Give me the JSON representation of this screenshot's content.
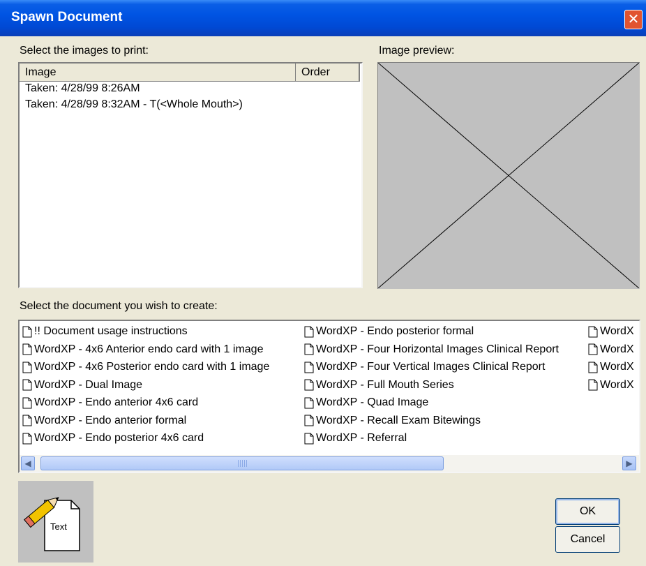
{
  "window": {
    "title": "Spawn Document",
    "close_glyph": "✕"
  },
  "images": {
    "label": "Select the images to print:",
    "columns": [
      "Image",
      "Order"
    ],
    "rows": [
      "Taken: 4/28/99  8:26AM",
      "Taken: 4/28/99  8:32AM - T(<Whole Mouth>)"
    ]
  },
  "preview": {
    "label": "Image preview:"
  },
  "documents": {
    "label": "Select the document you wish to create:",
    "col1": [
      "!!  Document usage instructions",
      "WordXP - 4x6 Anterior endo card with 1 image",
      "WordXP - 4x6 Posterior endo card with 1 image",
      "WordXP - Dual Image",
      "WordXP - Endo anterior 4x6 card",
      "WordXP - Endo anterior formal",
      "WordXP - Endo posterior 4x6 card"
    ],
    "col2": [
      "WordXP - Endo posterior formal",
      "WordXP - Four Horizontal Images Clinical Report",
      "WordXP - Four Vertical Images Clinical Report",
      "WordXP - Full Mouth Series",
      "WordXP - Quad Image",
      "WordXP - Recall Exam Bitewings",
      "WordXP - Referral"
    ],
    "col3": [
      "WordX",
      "WordX",
      "WordX",
      "WordX"
    ]
  },
  "scrollbar": {
    "left_arrow": "◀",
    "right_arrow": "▶"
  },
  "doc_icon": {
    "icon": "pencil-document-icon",
    "caption": "Text"
  },
  "buttons": {
    "ok": "OK",
    "cancel": "Cancel"
  },
  "colors": {
    "title_bar": "#0054e3",
    "dialog_bg": "#ece9d8",
    "preview_bg": "#c0c0c0",
    "close_button": "#e1542f"
  }
}
